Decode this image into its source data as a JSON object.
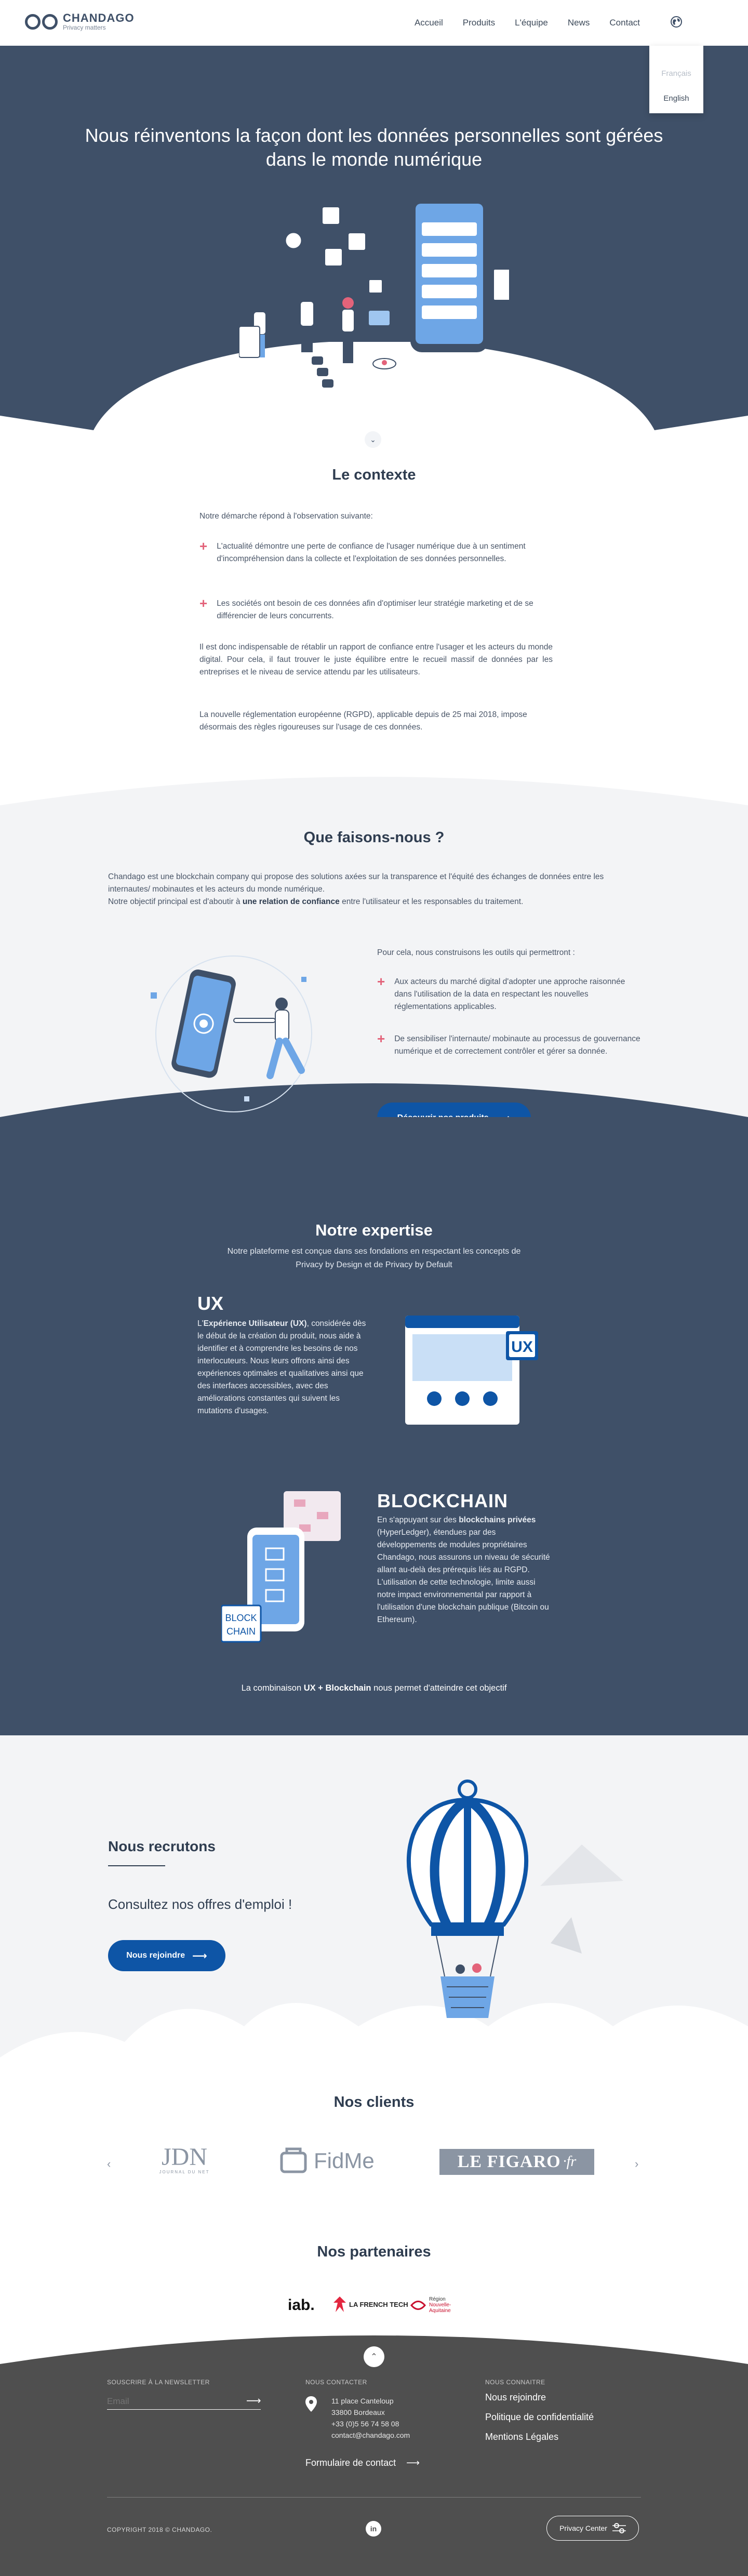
{
  "brand": {
    "name": "CHANDAGO",
    "tagline": "Privacy matters"
  },
  "nav": {
    "items": [
      "Accueil",
      "Produits",
      "L'équipe",
      "News",
      "Contact"
    ]
  },
  "language_menu": {
    "options": [
      "Français",
      "English"
    ],
    "selected": "English"
  },
  "hero": {
    "title": "Nous réinventons la façon dont les données personnelles sont gérées dans le monde numérique"
  },
  "contexte": {
    "title": "Le contexte",
    "intro": "Notre démarche répond à l'observation suivante:",
    "bullets": [
      "L'actualité démontre une perte de confiance de l'usager numérique due à un sentiment d'incompréhension dans la collecte et l'exploitation de ses données personnelles.",
      "Les sociétés ont besoin de ces données afin d'optimiser leur stratégie marketing et de se différencier de leurs concurrents."
    ],
    "para1": "Il est donc indispensable de rétablir un rapport de confiance entre l'usager et les acteurs du monde digital. Pour cela, il faut trouver le juste équilibre entre le recueil massif de données par les entreprises et le niveau de service attendu par les utilisateurs.",
    "para2": "La nouvelle réglementation européenne (RGPD), applicable depuis de 25 mai 2018, impose désormais des règles rigoureuses sur l'usage de ces données."
  },
  "faisons": {
    "title": "Que faisons-nous ?",
    "intro_1": "Chandago est une blockchain company qui propose des solutions axées sur la transparence et l'équité des échanges de données entre les internautes/ mobinautes et les acteurs du monde numérique.",
    "intro_2a": "Notre objectif principal est d'aboutir à ",
    "intro_2b": "une relation de confiance",
    "intro_2c": " entre l'utilisateur et les responsables du traitement.",
    "tools_intro": "Pour cela, nous construisons les outils qui permettront :",
    "bullets": [
      "Aux acteurs du marché digital d'adopter une approche raisonnée dans l'utilisation de la data en respectant les nouvelles réglementations applicables.",
      "De sensibiliser l'internaute/ mobinaute au processus de gouvernance numérique et de correctement contrôler et gérer sa donnée."
    ],
    "cta": "Découvrir nos produits"
  },
  "expertise": {
    "title": "Notre expertise",
    "subtitle": "Notre plateforme est conçue dans ses fondations en respectant les concepts de Privacy by Design et de Privacy by Default",
    "ux_title": "UX",
    "ux_lead": "L'",
    "ux_bold": "Expérience Utilisateur (UX)",
    "ux_body": ", considérée dès le début de la création du produit, nous aide à identifier et à comprendre les besoins de nos interlocuteurs. Nous leurs offrons ainsi des expériences optimales et qualitatives ainsi que des interfaces accessibles, avec des améliorations constantes qui suivent les mutations d'usages.",
    "ux_badge": "UX",
    "bc_title": "BLOCKCHAIN",
    "bc_lead": "En s'appuyant sur des ",
    "bc_bold": "blockchains privées",
    "bc_body": " (HyperLedger), étendues par des développements de modules propriétaires Chandago, nous assurons un niveau de sécurité allant au-delà des prérequis liés au RGPD. L'utilisation de cette technologie, limite aussi notre impact environnemental par rapport à l'utilisation d'une blockchain publique (Bitcoin ou Ethereum).",
    "bc_badge_1": "BLOCK",
    "bc_badge_2": "CHAIN",
    "foot_a": "La combinaison ",
    "foot_b": "UX + Blockchain",
    "foot_c": " nous permet d'atteindre cet objectif"
  },
  "recrutons": {
    "title": "Nous recrutons",
    "subtitle": "Consultez nos offres d'emploi !",
    "cta": "Nous rejoindre"
  },
  "clients": {
    "title": "Nos clients",
    "logos": [
      {
        "name": "JDN",
        "sub": "JOURNAL DU NET"
      },
      {
        "name": "FidMe"
      },
      {
        "name": "LE FIGARO",
        "suffix": "·fr"
      }
    ]
  },
  "partenaires": {
    "title": "Nos partenaires",
    "logos": [
      {
        "name": "iab."
      },
      {
        "name": "LA FRENCH TECH"
      },
      {
        "line1": "Région",
        "line2": "Nouvelle-",
        "line3": "Aquitaine"
      }
    ]
  },
  "footer": {
    "newsletter_label": "SOUSCRIRE À LA NEWSLETTER",
    "email_placeholder": "Email",
    "contact_label": "NOUS CONTACTER",
    "address": [
      "11 place Canteloup",
      "33800 Bordeaux",
      "+33 (0)5 56 74 58 08",
      "contact@chandago.com"
    ],
    "contact_form": "Formulaire de contact",
    "know_label": "NOUS CONNAITRE",
    "know_links": [
      "Nous rejoindre",
      "Politique de confidentialité",
      "Mentions Légales"
    ],
    "copyright": "COPYRIGHT 2018 © CHANDAGO.",
    "linkedin": "in",
    "privacy_center": "Privacy Center"
  },
  "colors": {
    "navy": "#3f5068",
    "accent_blue": "#0e55a6",
    "pink": "#e3637a",
    "footer": "#4f4f4f"
  }
}
